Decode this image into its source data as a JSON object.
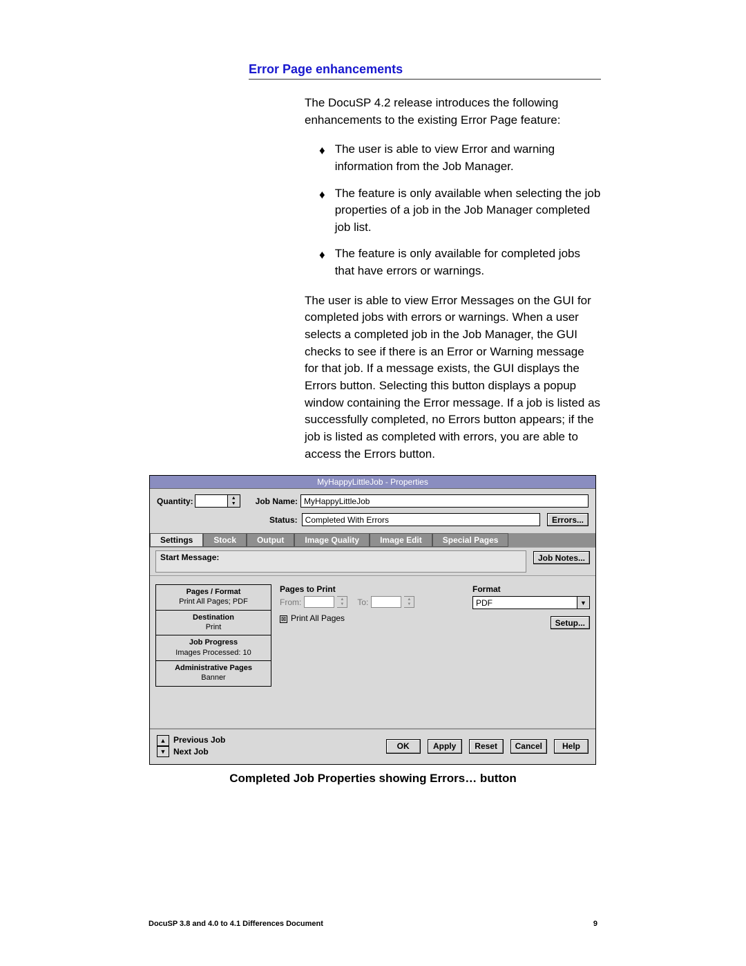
{
  "heading": "Error Page enhancements",
  "para1": "The DocuSP 4.2 release introduces the following enhancements to the existing Error Page feature:",
  "bullets": [
    "The user is able to view Error and warning information from the Job Manager.",
    "The feature is only available when selecting the job properties of a job in the Job Manager completed job list.",
    "The feature is only available for completed jobs that have errors or warnings."
  ],
  "para2": "The user is able to view Error Messages on the GUI for completed jobs with errors or warnings. When a user selects a completed job in the Job Manager, the GUI checks to see if there is an Error or Warning message for that job. If a message exists, the GUI displays the Errors button. Selecting this button displays a popup window containing the Error message. If a job is listed as successfully completed, no Errors button appears; if the job is listed as completed with errors, you are able to access the Errors button.",
  "caption": "Completed Job Properties showing Errors… button",
  "footer_left": "DocuSP 3.8 and 4.0 to 4.1 Differences Document",
  "footer_right": "9",
  "dialog": {
    "title": "MyHappyLittleJob - Properties",
    "quantity_label": "Quantity:",
    "jobname_label": "Job Name:",
    "jobname_value": "MyHappyLittleJob",
    "status_label": "Status:",
    "status_value": "Completed With Errors",
    "errors_btn": "Errors...",
    "tabs": [
      "Settings",
      "Stock",
      "Output",
      "Image Quality",
      "Image Edit",
      "Special Pages"
    ],
    "jobnotes_btn": "Job Notes...",
    "startmsg_label": "Start Message:",
    "cards": {
      "pages_format_h": "Pages / Format",
      "pages_format_v": "Print All Pages; PDF",
      "destination_h": "Destination",
      "destination_v": "Print",
      "jobprogress_h": "Job Progress",
      "jobprogress_v": "Images Processed: 10",
      "adminpages_h": "Administrative Pages",
      "adminpages_v": "Banner"
    },
    "pages_to_print_h": "Pages to Print",
    "from_label": "From:",
    "to_label": "To:",
    "print_all_pages": "Print All Pages",
    "format_h": "Format",
    "format_value": "PDF",
    "setup_btn": "Setup...",
    "prev_job": "Previous Job",
    "next_job": "Next Job",
    "buttons": {
      "ok": "OK",
      "apply": "Apply",
      "reset": "Reset",
      "cancel": "Cancel",
      "help": "Help"
    }
  }
}
